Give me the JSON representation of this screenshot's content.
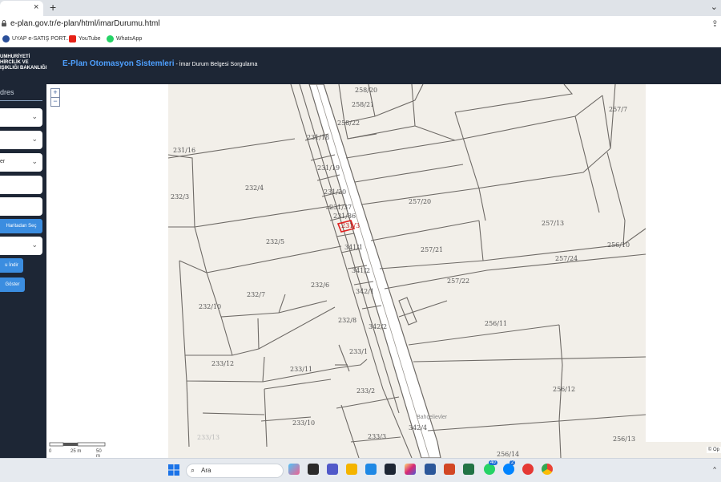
{
  "browser": {
    "tab_close": "×",
    "new_tab": "+",
    "tabs_menu": "⌄",
    "url": "e-plan.gov.tr/e-plan/html/imarDurumu.html"
  },
  "bookmarks": [
    {
      "label": "UYAP e-SATIŞ PORT...",
      "color": "#2a4f99"
    },
    {
      "label": "YouTube",
      "color": "#e62117"
    },
    {
      "label": "WhatsApp",
      "color": "#25d366"
    }
  ],
  "header": {
    "ministry_lines": [
      "UMHURİYETİ",
      "HİRCİLİK VE",
      "IŞIKLIĞI BAKANLIĞI"
    ],
    "app_title": "E-Plan Otomasyon Sistemleri",
    "separator": " - ",
    "subtitle": "İmar Durum Belgesi Sorgulama"
  },
  "sidebar": {
    "title": "dres",
    "fields": [
      {
        "value": "",
        "has_chevron": true
      },
      {
        "value": "",
        "has_chevron": true
      },
      {
        "value": "er",
        "has_chevron": true
      },
      {
        "value": "",
        "has_chevron": false
      },
      {
        "value": "",
        "has_chevron": false
      }
    ],
    "map_select_button": "Haritadan Seç",
    "dropdown_value": "",
    "download_button": "u İndir",
    "show_button": "Göster",
    "chevron": "⌄"
  },
  "map": {
    "zoom_in": "+",
    "zoom_out": "−",
    "scale_labels": [
      "0",
      "25 m",
      "50 m"
    ],
    "attribution": "© Op",
    "place_name": "Bahçelievler",
    "parcel_labels": [
      "258/20",
      "258/21",
      "258/22",
      "231/18",
      "231/16",
      "231/19",
      "231/20",
      "231/37",
      "231/36",
      "231/3",
      "341/1",
      "341/2",
      "342/1",
      "342/2",
      "342/4",
      "232/4",
      "232/3",
      "232/5",
      "232/6",
      "232/7",
      "232/8",
      "232/10",
      "233/1",
      "233/2",
      "233/3",
      "233/10",
      "233/11",
      "233/12",
      "233/13",
      "257/7",
      "257/20",
      "257/13",
      "257/21",
      "257/22",
      "257/24",
      "256/10",
      "256/11",
      "256/12",
      "256/13",
      "256/14"
    ],
    "highlight_color": "#e02020",
    "road_color": "#ffffff",
    "parcel_line_color": "#6e6a66",
    "background_color": "#f2efe9"
  },
  "taskbar": {
    "search_label": "Ara",
    "apps": [
      "windows-start",
      "search",
      "copilot",
      "widgets",
      "teams",
      "file-explorer",
      "store",
      "l-app",
      "instagram",
      "word",
      "powerpoint",
      "excel",
      "whatsapp",
      "messenger",
      "acrobat",
      "chrome"
    ],
    "badges": [
      "40",
      "2"
    ],
    "tray": "^"
  }
}
